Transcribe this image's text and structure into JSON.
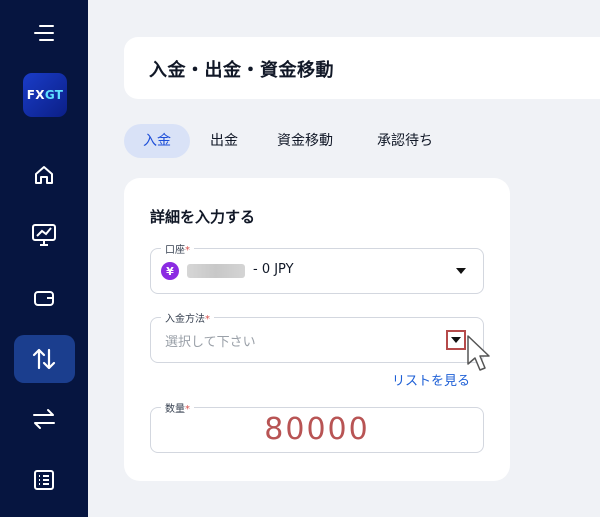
{
  "sidebar": {
    "logo": {
      "text_fx": "FX",
      "text_gt": "GT"
    },
    "icons": [
      "menu-icon",
      "home-icon",
      "chart-monitor-icon",
      "wallet-icon",
      "transfer-updown-icon",
      "swap-icon",
      "list-icon"
    ],
    "active_item": "transfer-updown-icon"
  },
  "header": {
    "title": "入金・出金・資金移動"
  },
  "tabs": [
    {
      "label": "入金",
      "active": true
    },
    {
      "label": "出金",
      "active": false
    },
    {
      "label": "資金移動",
      "active": false
    },
    {
      "label": "承認待ち",
      "active": false
    }
  ],
  "form": {
    "title": "詳細を入力する",
    "account": {
      "label": "口座",
      "required_mark": "*",
      "currency_symbol": "¥",
      "value": "- 0 JPY"
    },
    "method": {
      "label": "入金方法",
      "required_mark": "*",
      "placeholder": "選択して下さい",
      "link": "リストを見る"
    },
    "amount": {
      "label": "数量",
      "required_mark": "*",
      "value": "80000"
    }
  },
  "colors": {
    "sidebar_bg": "#061540",
    "accent": "#1d4ed8",
    "amount_text": "#b85454",
    "currency_badge": "#8b2be2"
  }
}
